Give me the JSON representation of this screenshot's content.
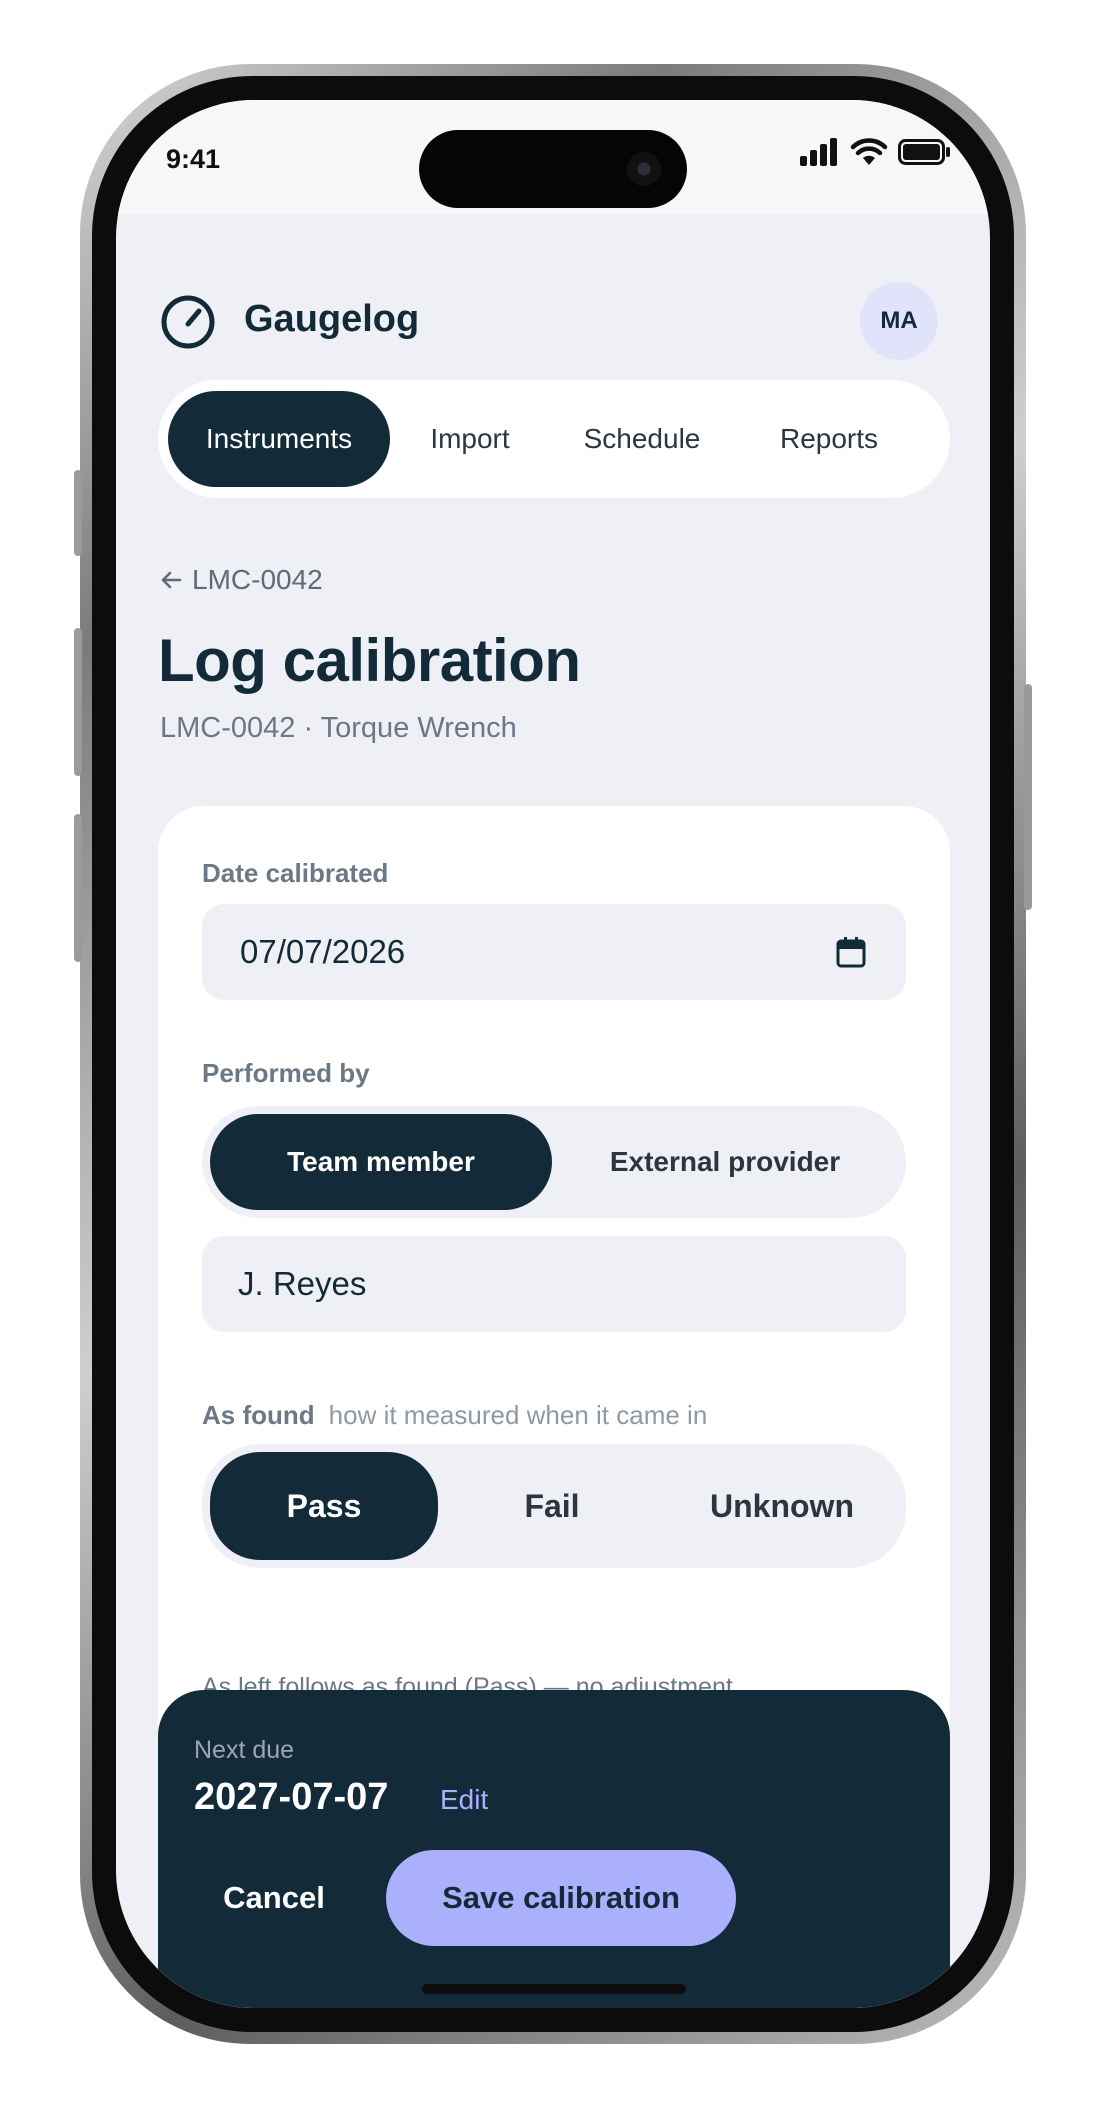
{
  "status_bar": {
    "time": "9:41"
  },
  "app": {
    "name": "Gaugelog",
    "avatar_initials": "MA"
  },
  "nav": {
    "tabs": [
      {
        "label": "Instruments",
        "active": true
      },
      {
        "label": "Import",
        "active": false
      },
      {
        "label": "Schedule",
        "active": false
      },
      {
        "label": "Reports",
        "active": false
      }
    ]
  },
  "page": {
    "back_label": "LMC-0042",
    "title": "Log calibration",
    "subtitle": "LMC-0042 · Torque Wrench"
  },
  "form": {
    "date": {
      "label": "Date calibrated",
      "value": "07/07/2026"
    },
    "performed_by": {
      "label": "Performed by",
      "options": [
        "Team member",
        "External provider"
      ],
      "selected": "Team member",
      "name_value": "J. Reyes"
    },
    "as_found": {
      "label": "As found",
      "hint": "how it measured when it came in",
      "options": [
        "Pass",
        "Fail",
        "Unknown"
      ],
      "selected": "Pass"
    },
    "note": "As left follows as found (Pass) — no adjustment recorded."
  },
  "footer": {
    "next_due_label": "Next due",
    "next_due_value": "2027-07-07",
    "edit_label": "Edit",
    "cancel_label": "Cancel",
    "save_label": "Save calibration"
  },
  "colors": {
    "primary": "#132b38",
    "accent": "#aab0fb",
    "background": "#eef0f6"
  }
}
